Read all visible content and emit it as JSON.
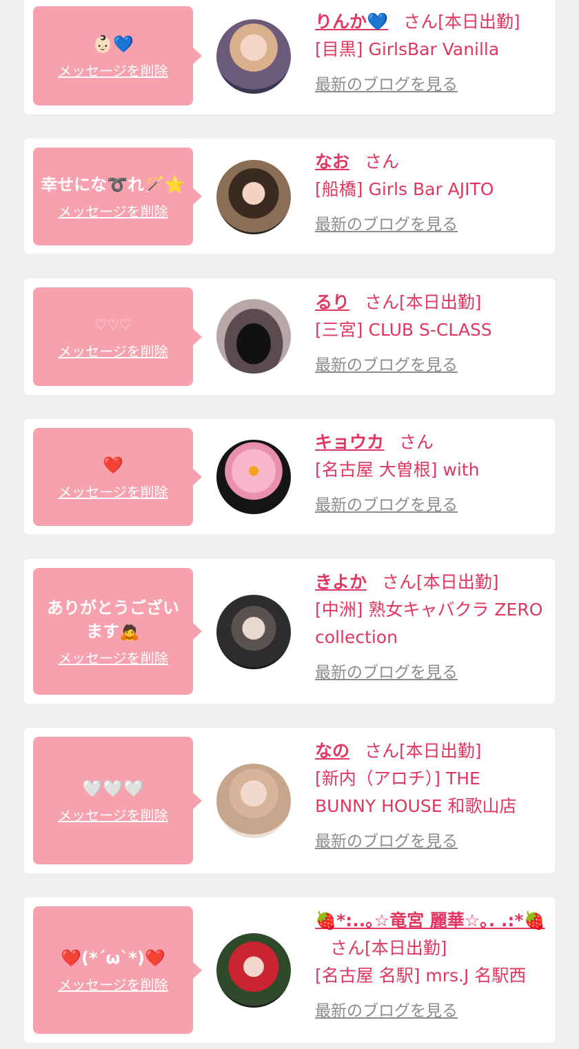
{
  "delete_label": "メッセージを削除",
  "blog_label": "最新のブログを見る",
  "honorific": "さん",
  "colors": {
    "bubble": "#f7a1ae",
    "name": "#e0365f",
    "blog": "#8c8c8c",
    "background": "#efefef"
  },
  "cards": [
    {
      "message": "👶🏻💙",
      "name": "りんか💙",
      "status": "[本日出勤]",
      "shop": "[目黒] GirlsBar Vanilla"
    },
    {
      "message": "幸せにな➰れ🪄⭐",
      "name": "なお",
      "status": "",
      "shop": "[船橋] Girls Bar AJITO"
    },
    {
      "message": "♡♡♡",
      "name": "るり",
      "status": "[本日出勤]",
      "shop": "[三宮] CLUB S-CLASS"
    },
    {
      "message": "❤️",
      "name": "キョウカ",
      "status": "",
      "shop": "[名古屋 大曽根] with"
    },
    {
      "message": "ありがとうございます🙇",
      "name": "きよか",
      "status": "[本日出勤]",
      "shop": "[中洲] 熟女キャバクラ ZERO collection"
    },
    {
      "message": "🤍🤍🤍",
      "name": "なの",
      "status": "[本日出勤]",
      "shop": "[新内（アロチ）] THE BUNNY HOUSE 和歌山店"
    },
    {
      "message": "❤️(*´ω`*)❤️",
      "name": "🍓*:..｡☆竜宮 麗華☆｡. .:*🍓",
      "status": "[本日出勤]",
      "shop": "[名古屋 名駅] mrs.J 名駅西"
    }
  ]
}
